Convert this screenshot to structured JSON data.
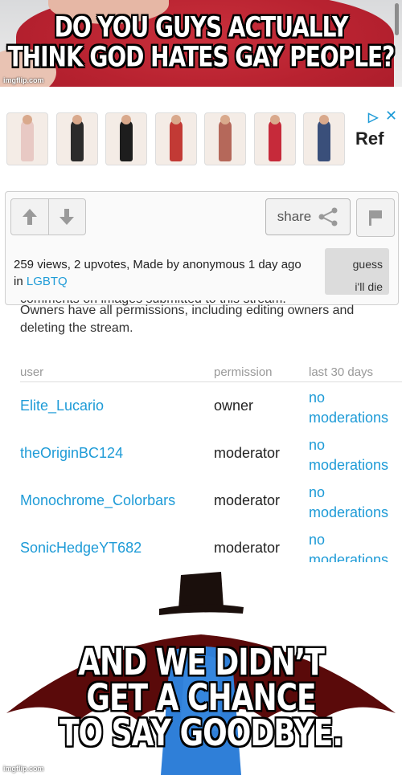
{
  "top_meme": {
    "line1": "DO YOU GUYS ACTUALLY",
    "line2": "THINK GOD HATES GAY PEOPLE?",
    "watermark": "imgflip.com"
  },
  "ad": {
    "brand": "Ref",
    "adchoices_icon": "adchoices-triangle-icon",
    "close_icon": "close-icon",
    "thumbnails": [
      {
        "outfit": "#e8c9c4"
      },
      {
        "outfit": "#2b2b2b"
      },
      {
        "outfit": "#1d1d1d"
      },
      {
        "outfit": "#c23a35"
      },
      {
        "outfit": "#b5685a"
      },
      {
        "outfit": "#c62a3a"
      },
      {
        "outfit": "#3a4f7a"
      }
    ]
  },
  "meta": {
    "upvote_icon": "arrow-up-icon",
    "downvote_icon": "arrow-down-icon",
    "share_label": "share",
    "share_icon": "share-icon",
    "flag_icon": "flag-icon",
    "stats_text": "259 views, 2 upvotes, Made by anonymous 1 day ago in",
    "stream_link": "LGBTQ",
    "tag_line1": "guess",
    "tag_line2": "i'll die"
  },
  "stream": {
    "cut_off_line": "comments on images submitted to this stream.",
    "description": "Owners have all permissions, including editing owners and deleting the stream.",
    "columns": [
      "user",
      "permission",
      "last 30 days"
    ],
    "rows": [
      {
        "user": "Elite_Lucario",
        "permission": "owner",
        "mod_line1": "no",
        "mod_line2": "moderations"
      },
      {
        "user": "theOriginBC124",
        "permission": "moderator",
        "mod_line1": "no",
        "mod_line2": "moderations"
      },
      {
        "user": "Monochrome_Colorbars",
        "permission": "moderator",
        "mod_line1": "no",
        "mod_line2": "moderations"
      },
      {
        "user": "SonicHedgeYT682",
        "permission": "moderator",
        "mod_line1": "no",
        "mod_line2": "moderations"
      }
    ]
  },
  "bottom_meme": {
    "line1": "AND WE DIDN’T",
    "line2": "GET A CHANCE",
    "line3": "TO SAY GOODBYE.",
    "watermark": "imgflip.com",
    "colors": {
      "hat": "#1a0f0c",
      "cape": "#5a0a0a",
      "body": "#2f7fd8"
    }
  }
}
